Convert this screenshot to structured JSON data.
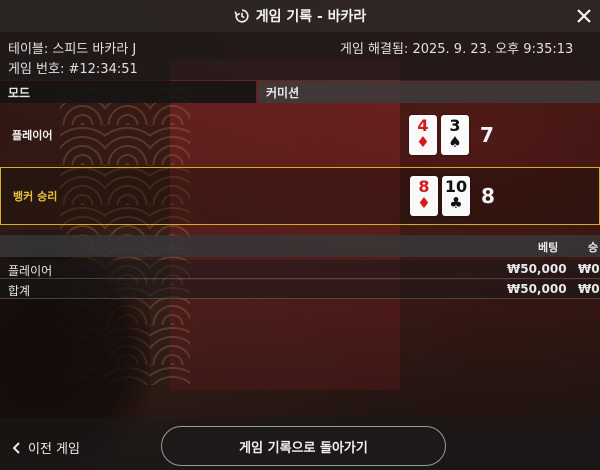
{
  "header": {
    "title": "게임 기록 - 바카라",
    "history_icon": "history-icon",
    "close_icon": "close-icon"
  },
  "info": {
    "table": "테이블: 스피드 바카라 J",
    "game_number": "게임 번호: #12:34:51",
    "resolved": "게임 해결됨: 2025. 9. 23. 오후 9:35:13"
  },
  "mode_row": {
    "mode_label": "모드",
    "commission_label": "커미션"
  },
  "results": {
    "player": {
      "label": "플레이어",
      "cards": [
        {
          "rank": "4",
          "suit": "♦",
          "color": "#d31b1b"
        },
        {
          "rank": "3",
          "suit": "♠",
          "color": "#111111"
        }
      ],
      "score": "7"
    },
    "banker": {
      "label": "뱅커 승리",
      "cards": [
        {
          "rank": "8",
          "suit": "♦",
          "color": "#d31b1b"
        },
        {
          "rank": "10",
          "suit": "♣",
          "color": "#111111"
        }
      ],
      "score": "8",
      "highlight_color": "#d4b020"
    }
  },
  "bets": {
    "headers": {
      "bet": "베팅",
      "win": "승"
    },
    "rows": [
      {
        "name": "플레이어",
        "amount": "₩50,000",
        "win": "₩0"
      },
      {
        "name": "합계",
        "amount": "₩50,000",
        "win": "₩0"
      }
    ]
  },
  "footer": {
    "prev_label": "이전 게임",
    "back_label": "게임 기록으로 돌아가기",
    "chevron_icon": "chevron-left-icon"
  }
}
